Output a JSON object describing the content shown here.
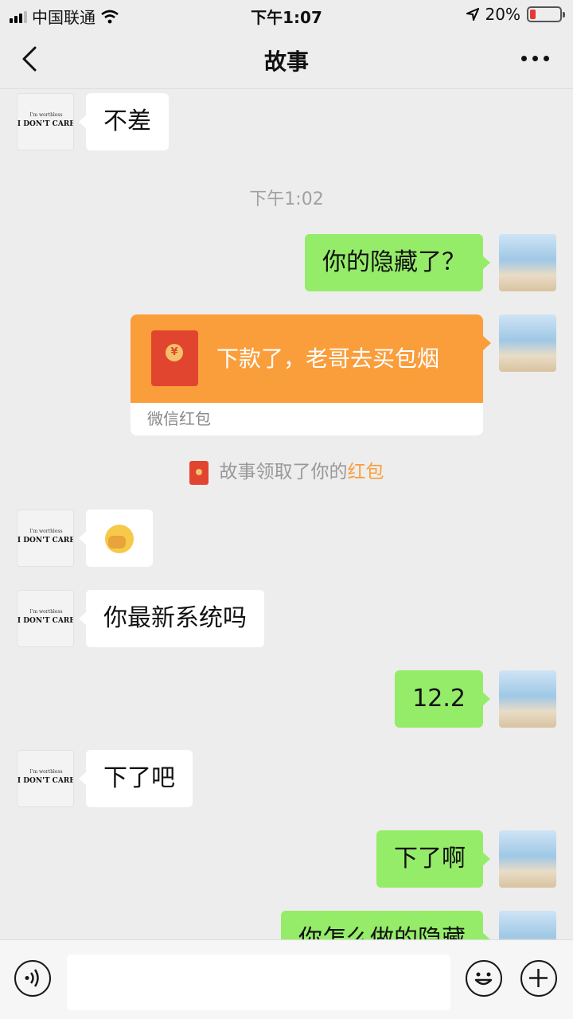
{
  "status": {
    "carrier": "中国联通",
    "time": "下午1:07",
    "battery_percent": "20%",
    "battery_level": 0.2
  },
  "nav": {
    "title": "故事"
  },
  "messages": {
    "m1": "不差",
    "timestamp": "下午1:02",
    "m2": "你的隐藏了？",
    "red_packet": {
      "text": "下款了，老哥去买包烟",
      "footer": "微信红包"
    },
    "system": {
      "prefix": "故事领取了你的",
      "highlight": "红包"
    },
    "m4": "你最新系统吗",
    "m5": "12.2",
    "m6": "下了吧",
    "m7": "下了啊",
    "m8": "你怎么做的隐藏"
  },
  "avatar_other": {
    "line1": "I'm worthless",
    "line2": "I DON'T CARE"
  },
  "colors": {
    "sent_bubble": "#95ec69",
    "red_packet": "#fa9d3b",
    "accent_text": "#fa9d3b"
  }
}
